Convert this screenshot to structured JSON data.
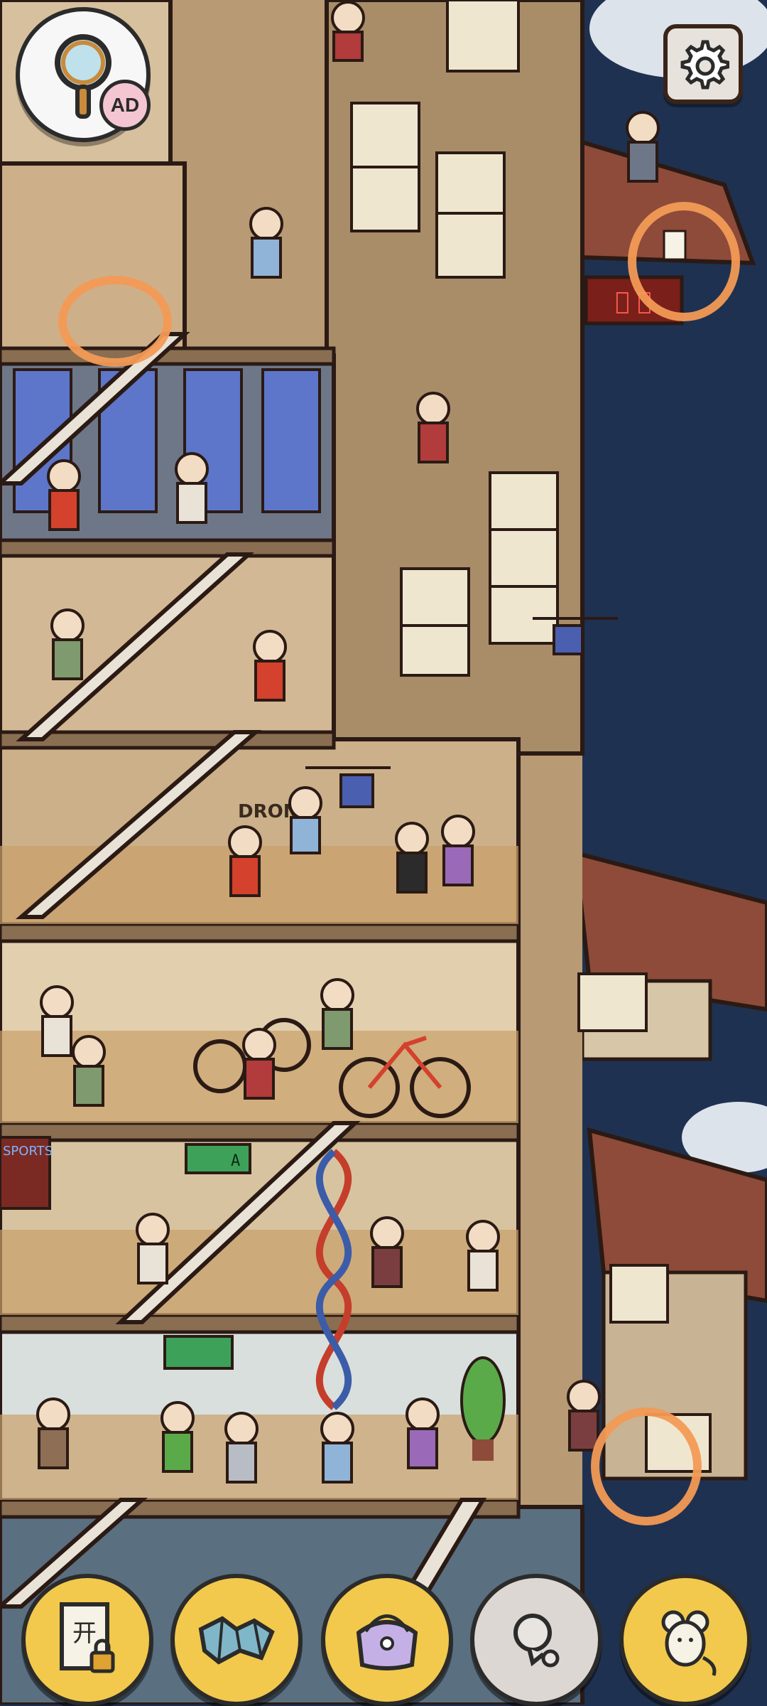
{
  "hud": {
    "zoom_ad_label": "AD",
    "zoom_icon": "magnifier-icon",
    "settings_icon": "gear-icon"
  },
  "scene": {
    "shop_sign": "𫍭 図",
    "robot_screen_text": "A",
    "drone_shop_sign": "DRONE",
    "wall_sign": "SPORTS"
  },
  "toolbar": {
    "buttons": [
      {
        "name": "locked-document-icon",
        "glyph": "开",
        "state": "active"
      },
      {
        "name": "map-icon",
        "state": "active"
      },
      {
        "name": "bag-icon",
        "state": "active"
      },
      {
        "name": "hint-icon",
        "state": "disabled"
      },
      {
        "name": "mouse-icon",
        "state": "active"
      }
    ]
  },
  "colors": {
    "accent": "#f2c94c",
    "marker": "#f39a55",
    "sky": "#1f3150",
    "wood": "#c8a77c",
    "roof": "#8e4b3a"
  }
}
